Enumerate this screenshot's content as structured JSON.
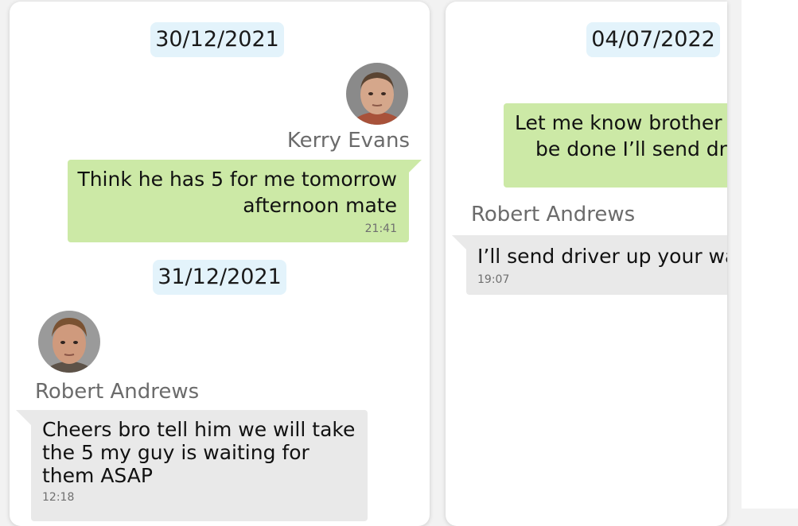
{
  "left_panel": {
    "date_1": "30/12/2021",
    "sender_1": "Kerry Evans",
    "message_1": {
      "text": "Think he has 5 for me tomorrow afternoon mate",
      "time": "21:41"
    },
    "date_2": "31/12/2021",
    "sender_2": "Robert Andrews",
    "message_2": {
      "text": "Cheers bro tell him we will take the 5 my guy is waiting for them ASAP",
      "time": "12:18"
    }
  },
  "right_panel": {
    "date_1": "04/07/2022",
    "message_1": {
      "text_line_1": "Let me know brother",
      "text_line_2": "be done I’ll send dr"
    },
    "sender_1": "Robert Andrews",
    "message_2": {
      "text": "I’ll send driver up your wa",
      "time": "19:07"
    }
  },
  "colors": {
    "outgoing_bubble": "#cce9a6",
    "incoming_bubble": "#e9e9e9",
    "date_chip": "#e3f3fb",
    "sender_name": "#6b6b6b"
  }
}
